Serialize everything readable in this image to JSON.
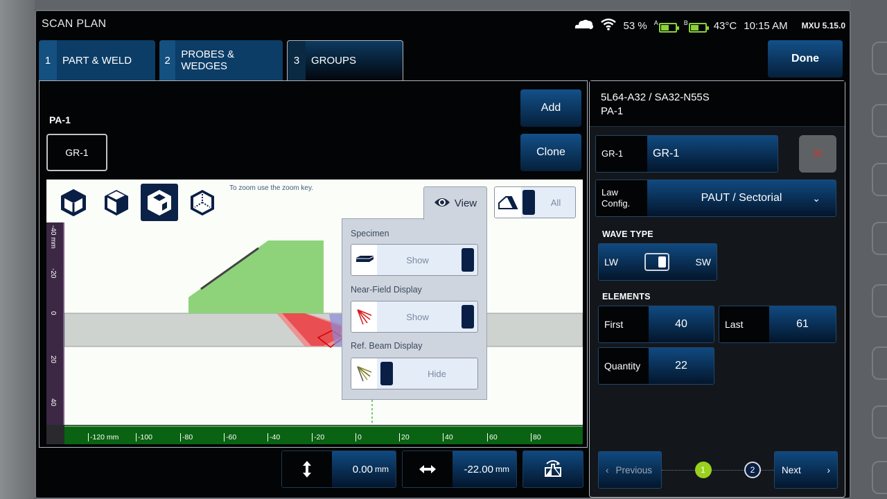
{
  "app": {
    "title": "SCAN PLAN"
  },
  "status": {
    "battery_percent": "53 %",
    "battery_a": {
      "label": "A",
      "level": 0.5
    },
    "battery_b": {
      "label": "B",
      "level": 0.5
    },
    "temperature": "43°C",
    "time": "10:15 AM",
    "version": "MXU  5.15.0",
    "icons": [
      "cloud-icon",
      "wifi-icon"
    ]
  },
  "tabs": [
    {
      "num": "1",
      "label": "PART & WELD",
      "active": false
    },
    {
      "num": "2",
      "label": "PROBES & WEDGES",
      "active": false
    },
    {
      "num": "3",
      "label": "GROUPS",
      "active": true
    }
  ],
  "done_label": "Done",
  "left": {
    "probe_label": "PA-1",
    "group_chip": "GR-1",
    "add_label": "Add",
    "clone_label": "Clone",
    "zoom_hint": "To zoom use the zoom key.",
    "view_modes": [
      "3d-view-front",
      "3d-view-side",
      "3d-view-iso",
      "3d-view-hidden"
    ],
    "active_view_mode": 2,
    "view_button_label": "View",
    "all_toggle_label": "All",
    "popup": {
      "specimen": {
        "title": "Specimen",
        "state": "Show"
      },
      "near_field": {
        "title": "Near-Field Display",
        "state": "Show"
      },
      "ref_beam": {
        "title": "Ref. Beam Display",
        "state": "Hide"
      }
    },
    "ruler_v": [
      "-40 mm",
      "-20",
      "0",
      "20",
      "40"
    ],
    "ruler_h": [
      "-120 mm",
      "-100",
      "-80",
      "-60",
      "-40",
      "-20",
      "0",
      "20",
      "40",
      "60",
      "80"
    ],
    "vertical_offset": {
      "value": "0.00",
      "unit": "mm"
    },
    "horizontal_offset": {
      "value": "-22.00",
      "unit": "mm"
    }
  },
  "right": {
    "header_line1": "5L64-A32 / SA32-N55S",
    "header_line2": "PA-1",
    "group_field": {
      "key": "GR-1",
      "value": "GR-1"
    },
    "law_config": {
      "key_line1": "Law",
      "key_line2": "Config.",
      "value": "PAUT / Sectorial"
    },
    "wave_type": {
      "title": "WAVE TYPE",
      "left": "LW",
      "right": "SW",
      "selected": "SW"
    },
    "elements": {
      "title": "ELEMENTS",
      "first": {
        "label": "First",
        "value": "40"
      },
      "last": {
        "label": "Last",
        "value": "61"
      },
      "quantity": {
        "label": "Quantity",
        "value": "22"
      }
    },
    "nav": {
      "previous": "Previous",
      "next": "Next",
      "steps": [
        "1",
        "2"
      ],
      "current_step": 1
    }
  },
  "colors": {
    "accent_blue": "#104a80",
    "step_active": "#9ad01e",
    "wedge_green": "#8ed37a",
    "specimen_gray": "#cfd3cf",
    "beam_red": "#e8141e",
    "ruler_h_green": "#0a6312",
    "ruler_v_purple": "#3c2844"
  }
}
